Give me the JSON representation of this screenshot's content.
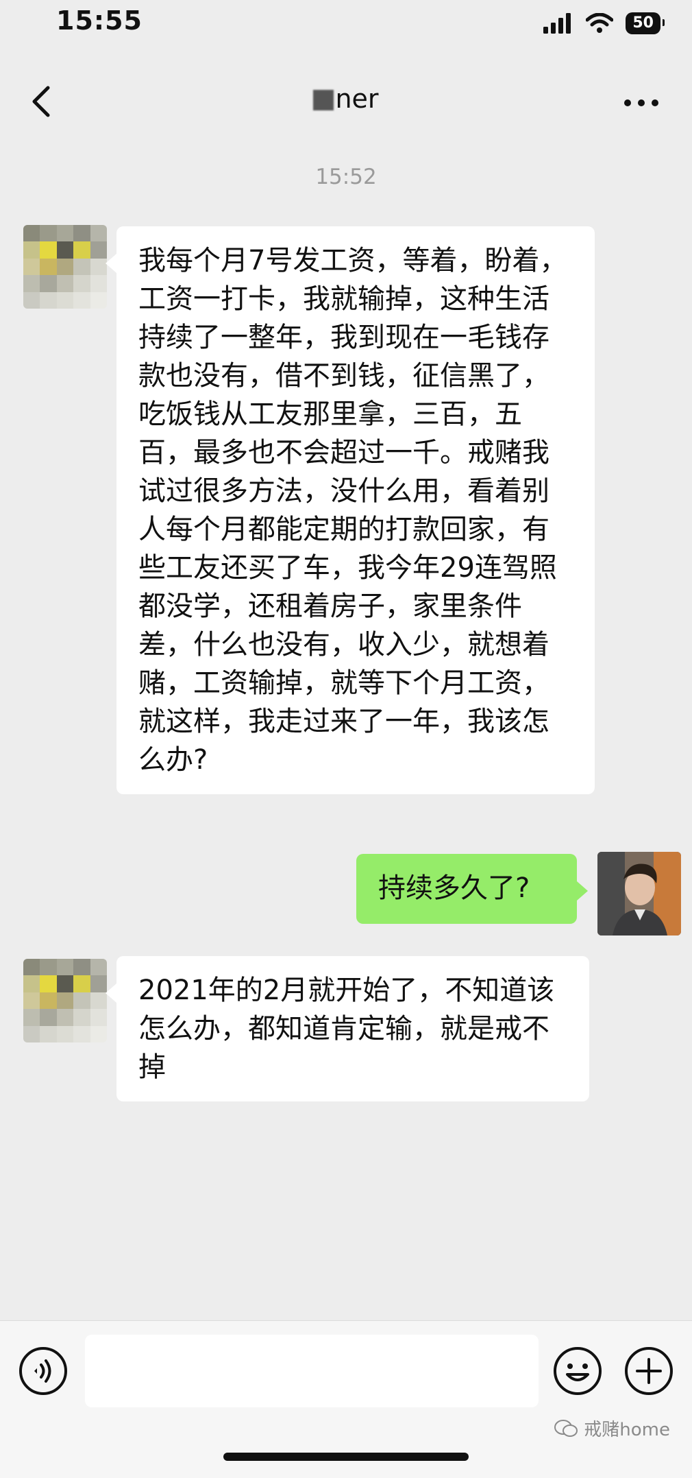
{
  "status_bar": {
    "time": "15:55",
    "battery": "50"
  },
  "nav": {
    "title": "ner"
  },
  "timestamp": "15:52",
  "messages": [
    {
      "side": "left",
      "text": "我每个月7号发工资，等着，盼着，工资一打卡，我就输掉，这种生活持续了一整年，我到现在一毛钱存款也没有，借不到钱，征信黑了，吃饭钱从工友那里拿，三百，五百，最多也不会超过一千。戒赌我试过很多方法，没什么用，看着别人每个月都能定期的打款回家，有些工友还买了车，我今年29连驾照都没学，还租着房子，家里条件差，什么也没有，收入少，就想着赌，工资输掉，就等下个月工资，就这样，我走过来了一年，我该怎么办?"
    },
    {
      "side": "right",
      "text": "持续多久了?"
    },
    {
      "side": "left",
      "text": "2021年的2月就开始了，不知道该怎么办，都知道肯定输，就是戒不掉"
    }
  ],
  "input_bar": {
    "placeholder": ""
  },
  "watermark": "戒赌home",
  "icons": {
    "back": "chevron-left-icon",
    "more": "more-dots-icon",
    "voice": "voice-icon",
    "emoji": "emoji-icon",
    "plus": "plus-icon",
    "signal": "signal-icon",
    "wifi": "wifi-icon"
  },
  "colors": {
    "background": "#ededed",
    "bubble_incoming": "#ffffff",
    "bubble_outgoing": "#95ec69",
    "timestamp_text": "#9a9a9a"
  }
}
